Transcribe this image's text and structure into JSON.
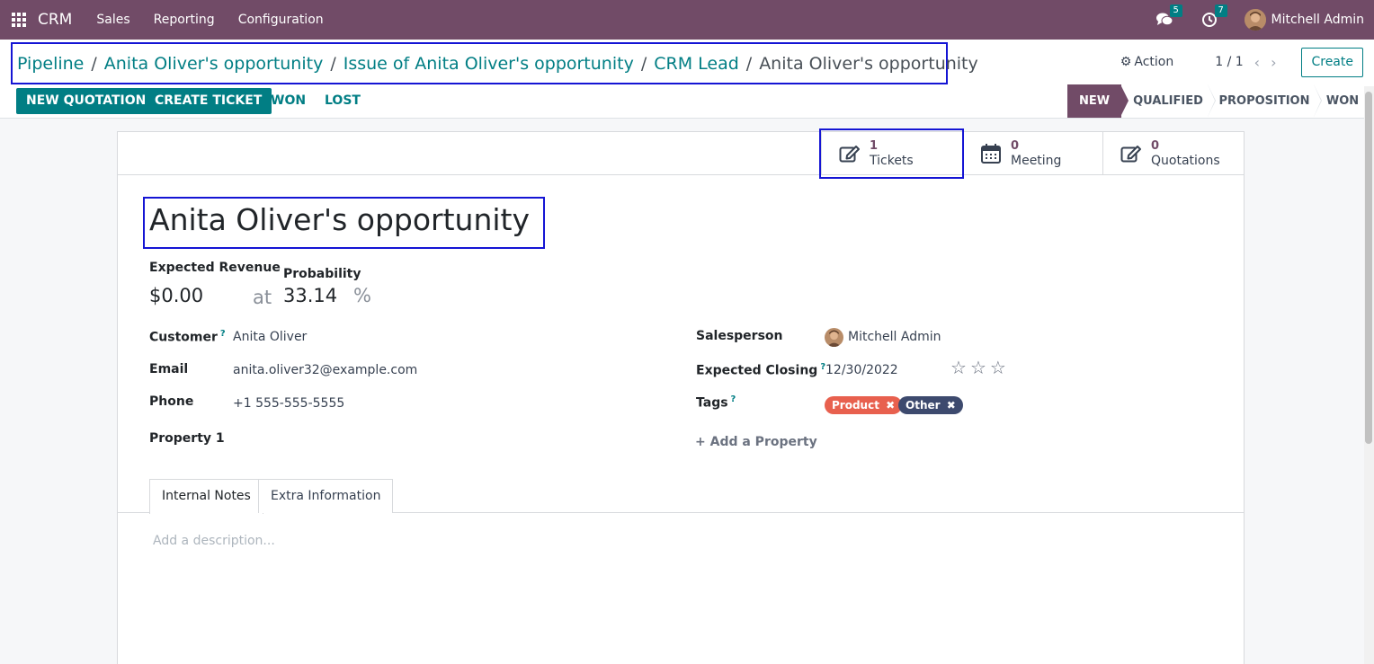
{
  "navbar": {
    "app_name": "CRM",
    "menus": [
      "Sales",
      "Reporting",
      "Configuration"
    ],
    "messages_count": "5",
    "activities_count": "7",
    "user_name": "Mitchell Admin"
  },
  "breadcrumb": {
    "items": [
      "Pipeline",
      "Anita Oliver's opportunity",
      "Issue of Anita Oliver's opportunity",
      "CRM Lead"
    ],
    "separator": "/",
    "current": "Anita Oliver's opportunity"
  },
  "control": {
    "action_label": "Action",
    "pager": "1 / 1",
    "create_label": "Create"
  },
  "header_buttons": {
    "new_quotation": "NEW QUOTATION",
    "create_ticket": "CREATE TICKET",
    "won": "WON",
    "lost": "LOST"
  },
  "stages": {
    "items": [
      "NEW",
      "QUALIFIED",
      "PROPOSITION",
      "WON"
    ],
    "active": "NEW"
  },
  "smart_buttons": [
    {
      "count": "1",
      "label": "Tickets",
      "icon": "pencil-square-icon"
    },
    {
      "count": "0",
      "label": "Meeting",
      "icon": "calendar-icon"
    },
    {
      "count": "0",
      "label": "Quotations",
      "icon": "pencil-square-icon"
    }
  ],
  "form": {
    "title": "Anita Oliver's opportunity",
    "expected_revenue_label": "Expected Revenue",
    "expected_revenue": "$0.00",
    "at": "at",
    "probability_label": "Probability",
    "probability": "33.14",
    "percent": "%",
    "customer_label": "Customer",
    "help_mark": "?",
    "customer": "Anita Oliver",
    "email_label": "Email",
    "email": "anita.oliver32@example.com",
    "phone_label": "Phone",
    "phone": "+1 555-555-5555",
    "property_label": "Property 1",
    "salesperson_label": "Salesperson",
    "salesperson": "Mitchell Admin",
    "closing_label": "Expected Closing",
    "closing": "12/30/2022",
    "priority_stars": 0,
    "tags_label": "Tags",
    "tags": [
      {
        "name": "Product",
        "color": "#e8604e"
      },
      {
        "name": "Other",
        "color": "#3d4a6e"
      }
    ],
    "add_property": "Add a Property"
  },
  "tabs": [
    "Internal Notes",
    "Extra Information"
  ],
  "notes_placeholder": "Add a description...",
  "colors": {
    "brand": "#714b67",
    "accent": "#017e84",
    "highlight": "#1515d4"
  }
}
